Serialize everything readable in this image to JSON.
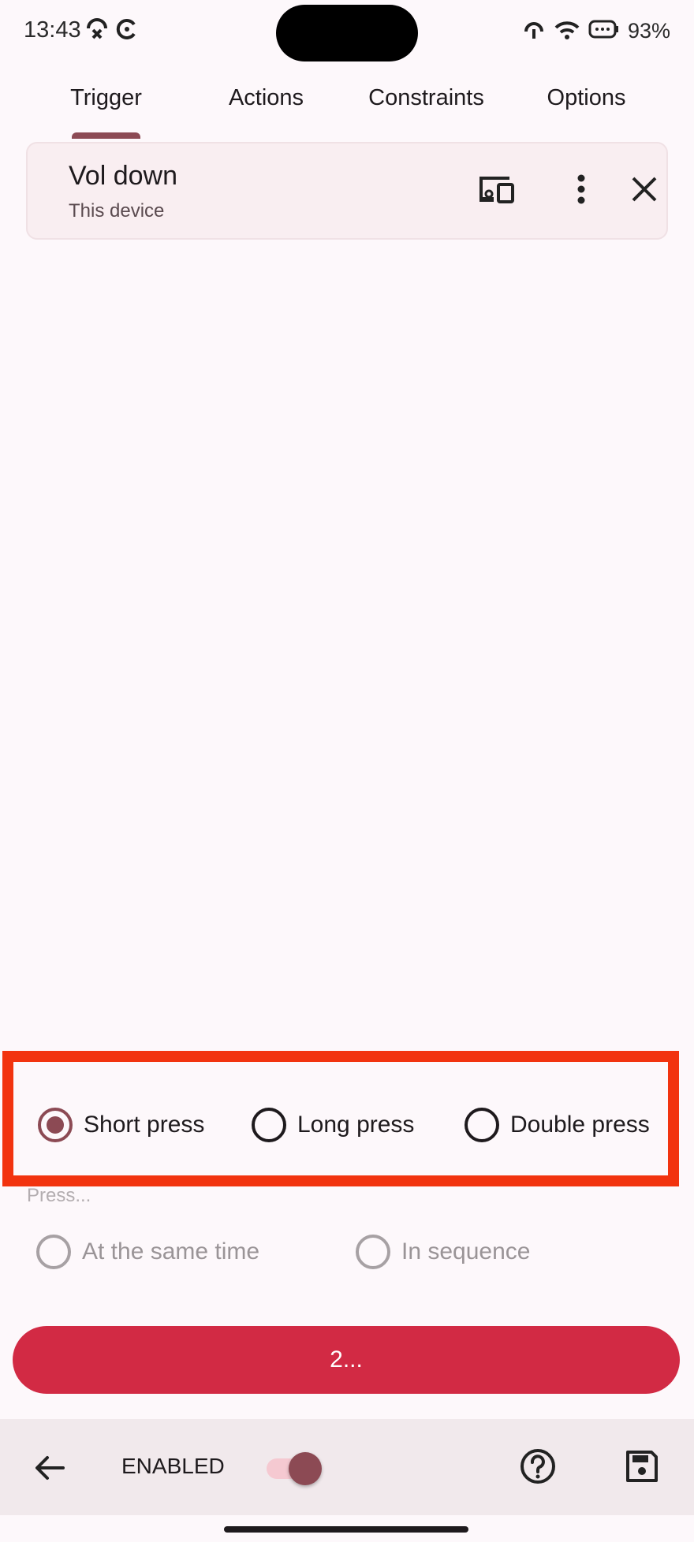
{
  "status_bar": {
    "time": "13:43",
    "battery": "93%",
    "left_icons": [
      "missed-call-icon",
      "sync-icon"
    ],
    "right_icons": [
      "hotspot-icon",
      "wifi-icon",
      "battery-icon"
    ]
  },
  "tabs": [
    {
      "label": "Trigger",
      "active": true
    },
    {
      "label": "Actions",
      "active": false
    },
    {
      "label": "Constraints",
      "active": false
    },
    {
      "label": "Options",
      "active": false
    }
  ],
  "trigger": {
    "title": "Vol down",
    "subtitle": "This device",
    "icons": [
      "devices-icon",
      "more-vert-icon",
      "close-icon"
    ]
  },
  "press_type": {
    "options": [
      {
        "label": "Short press",
        "selected": true
      },
      {
        "label": "Long press",
        "selected": false
      },
      {
        "label": "Double press",
        "selected": false
      }
    ]
  },
  "press_mode": {
    "caption": "Press...",
    "options": [
      {
        "label": "At the same time",
        "enabled": false
      },
      {
        "label": "In sequence",
        "enabled": false
      }
    ]
  },
  "main_button": {
    "label": "2..."
  },
  "bottom_bar": {
    "enabled_label": "ENABLED",
    "toggle_on": true,
    "icons": [
      "back-arrow-icon",
      "help-icon",
      "save-icon"
    ]
  },
  "colors": {
    "accent": "#8c4a54",
    "button": "#d22a44",
    "highlight_border": "#f2330f"
  }
}
